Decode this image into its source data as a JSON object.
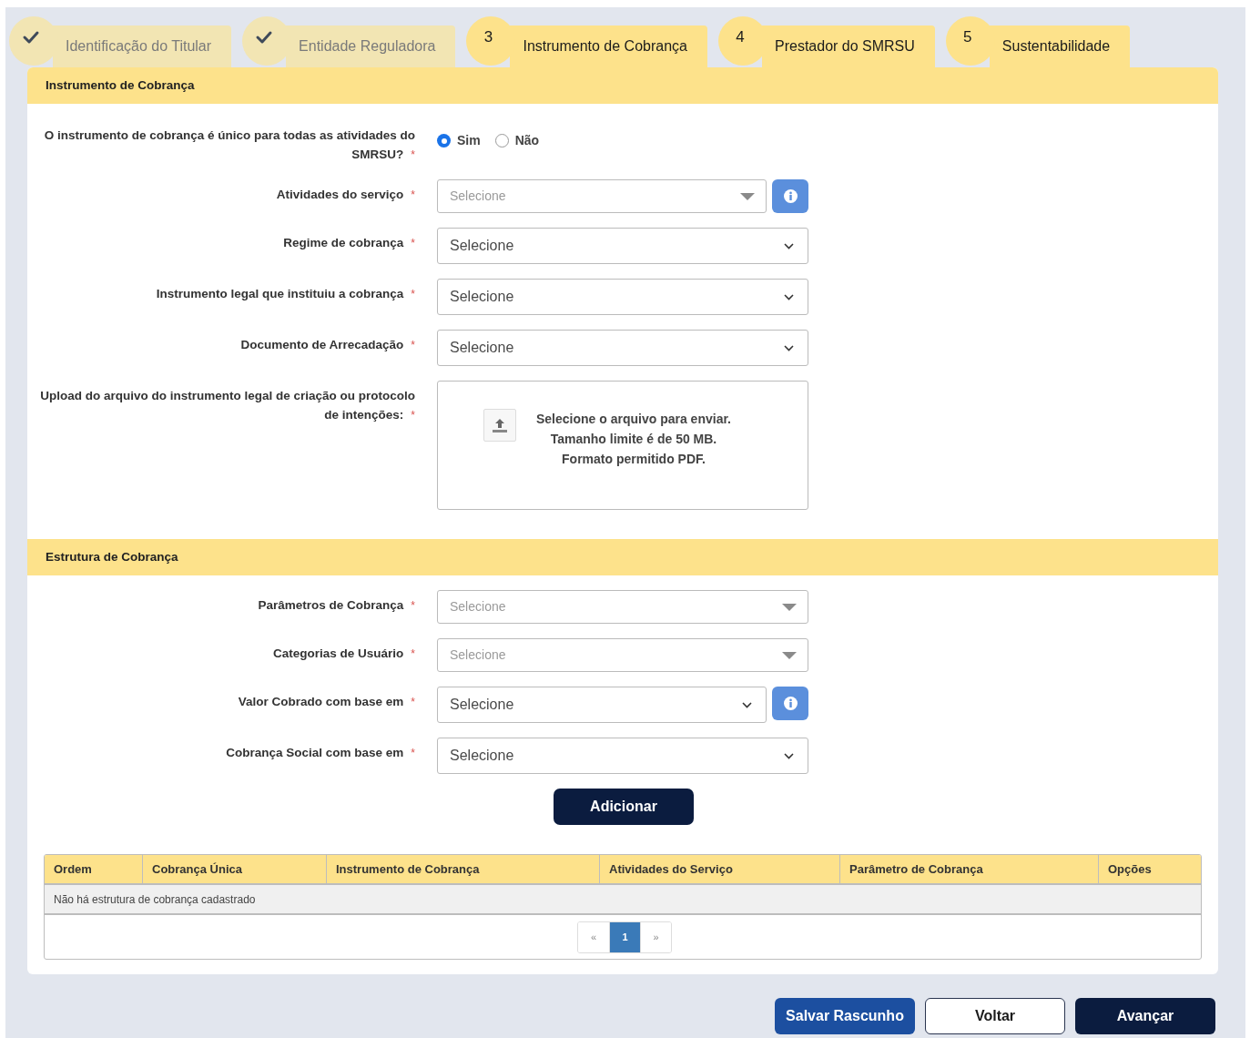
{
  "steps": [
    {
      "label": "Identificação do Titular",
      "done": true
    },
    {
      "label": "Entidade Reguladora",
      "done": true
    },
    {
      "label": "Instrumento de Cobrança",
      "number": "3",
      "done": false
    },
    {
      "label": "Prestador do SMRSU",
      "number": "4",
      "done": false
    },
    {
      "label": "Sustentabilidade",
      "number": "5",
      "done": false
    }
  ],
  "sections": [
    {
      "title": "Instrumento de Cobrança",
      "fields": [
        {
          "kind": "radio",
          "label": "O instrumento de cobrança é único para todas as atividades do SMRSU?",
          "marker": "*",
          "options": [
            {
              "label": "Sim",
              "selected": true
            },
            {
              "label": "Não",
              "selected": false
            }
          ]
        },
        {
          "kind": "combo",
          "label": "Atividades do serviço",
          "marker": "*",
          "placeholder": "Selecione",
          "info": true
        },
        {
          "kind": "native",
          "label": "Regime de cobrança",
          "marker": "*",
          "value": "Selecione",
          "info": false
        },
        {
          "kind": "native",
          "label": "Instrumento legal que instituiu a cobrança",
          "marker": "*",
          "value": "Selecione",
          "info": false
        },
        {
          "kind": "native",
          "label": "Documento de Arrecadação",
          "marker": "*",
          "value": "Selecione",
          "info": false
        },
        {
          "kind": "upload",
          "label": "Upload do arquivo do instrumento legal de criação ou protocolo de intenções:",
          "marker": "*",
          "lines": [
            "Selecione o arquivo para enviar.",
            "Tamanho limite é de 50 MB.",
            "Formato permitido PDF."
          ]
        }
      ]
    },
    {
      "title": "Estrutura de Cobrança",
      "fields": [
        {
          "kind": "combo",
          "label": "Parâmetros de Cobrança",
          "marker": "*",
          "placeholder": "Selecione",
          "info": false
        },
        {
          "kind": "combo",
          "label": "Categorias de Usuário",
          "marker": "*",
          "placeholder": "Selecione",
          "info": false
        },
        {
          "kind": "native",
          "label": "Valor Cobrado com base em",
          "marker": "*",
          "value": "Selecione",
          "info": true
        },
        {
          "kind": "native",
          "label": "Cobrança Social com base em",
          "marker": "*",
          "value": "Selecione",
          "info": false
        }
      ],
      "add_button": "Adicionar",
      "table": {
        "columns": [
          "Ordem",
          "Cobrança Única",
          "Instrumento de Cobrança",
          "Atividades do Serviço",
          "Parâmetro de Cobrança",
          "Opções"
        ],
        "empty_message": "Não há estrutura de cobrança cadastrado",
        "pagination": [
          {
            "label": "«",
            "selected": false
          },
          {
            "label": "1",
            "selected": true
          },
          {
            "label": "»",
            "selected": false
          }
        ]
      }
    }
  ],
  "buttons": [
    {
      "label": "Salvar Rascunho",
      "kind": "secondary"
    },
    {
      "label": "Voltar",
      "kind": "outline"
    },
    {
      "label": "Avançar",
      "kind": "primary"
    }
  ]
}
